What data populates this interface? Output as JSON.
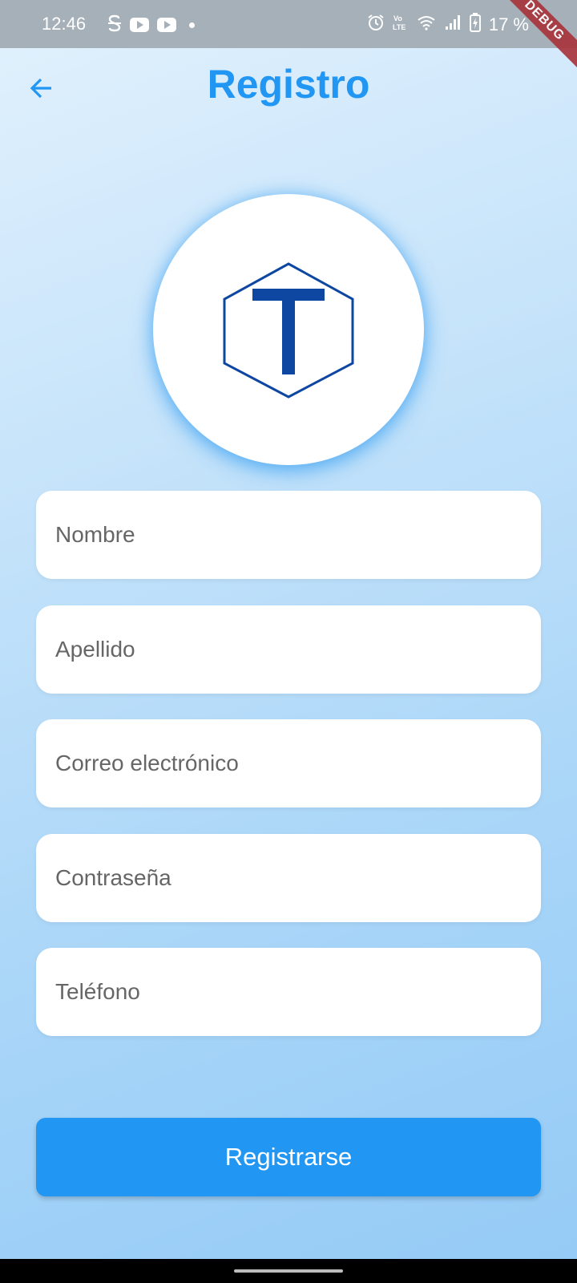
{
  "status_bar": {
    "time": "12:46",
    "battery_percent": "17 %",
    "left_icons": [
      "s-notification-icon",
      "youtube-icon",
      "youtube-icon",
      "dot-icon"
    ],
    "right_icons": [
      "alarm-icon",
      "volte-icon",
      "wifi-icon",
      "signal-icon",
      "battery-charging-icon"
    ]
  },
  "debug_banner": "DEBUG",
  "header": {
    "title": "Registro",
    "back_icon": "arrow-left-icon"
  },
  "logo": {
    "letter": "T",
    "icon": "hexagon-t-logo",
    "color": "#0d47a1"
  },
  "form": {
    "fields": [
      {
        "placeholder": "Nombre",
        "value": ""
      },
      {
        "placeholder": "Apellido",
        "value": ""
      },
      {
        "placeholder": "Correo electrónico",
        "value": ""
      },
      {
        "placeholder": "Contraseña",
        "value": ""
      },
      {
        "placeholder": "Teléfono",
        "value": ""
      }
    ],
    "submit_label": "Registrarse"
  },
  "colors": {
    "accent": "#2196f3",
    "logo": "#0d47a1",
    "status_bar": "#a6b0b9",
    "debug_banner": "#a8323a"
  }
}
